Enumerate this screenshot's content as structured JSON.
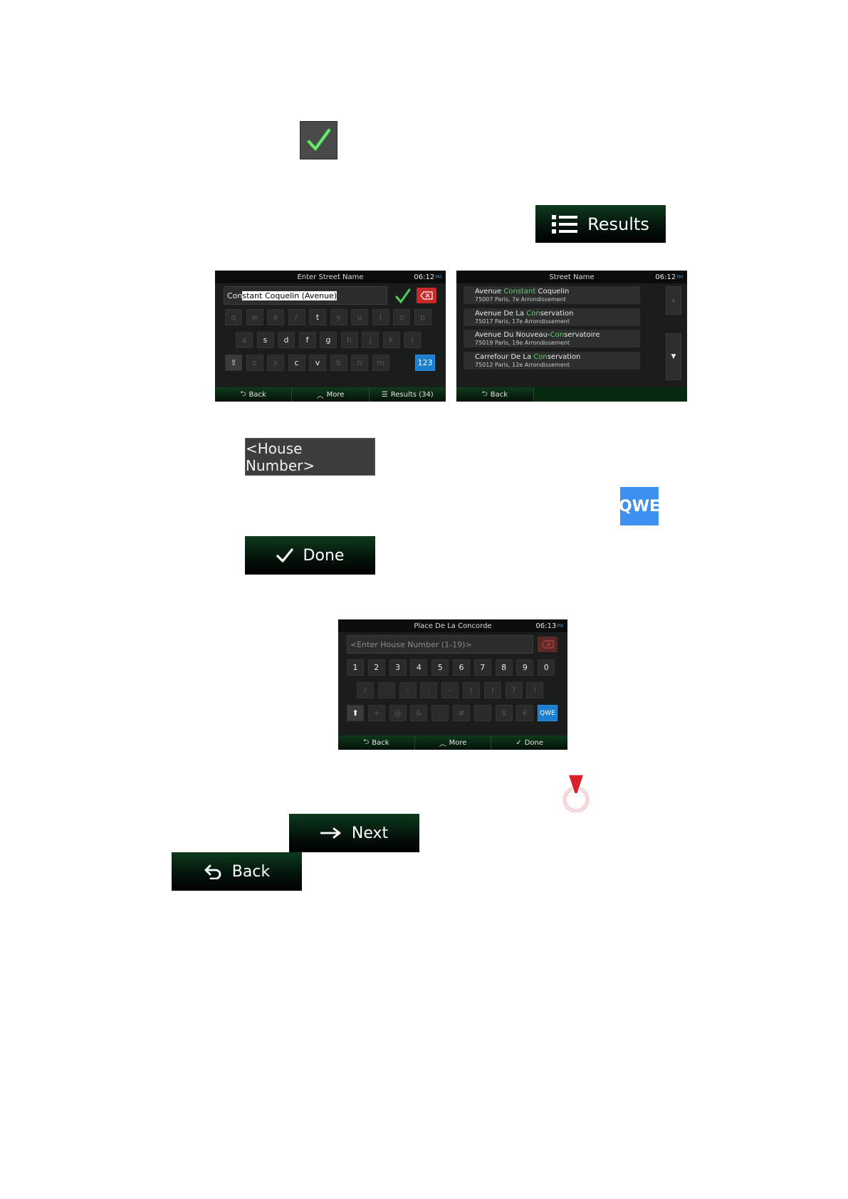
{
  "buttons": {
    "results_label": "Results",
    "house_number_label": "<House Number>",
    "qwe_label": "QWE",
    "done_label": "Done",
    "next_label": "Next",
    "back_label": "Back"
  },
  "screen_street_entry": {
    "title": "Enter Street Name",
    "time": "06:12",
    "time_suffix": "PM",
    "input_typed": "Con",
    "input_suggestion": "stant Coquelin (Avenue)",
    "keyboard": {
      "row1": [
        "q",
        "w",
        "e",
        "r",
        "t",
        "y",
        "u",
        "i",
        "o",
        "p"
      ],
      "row1_active": [
        false,
        false,
        false,
        false,
        true,
        false,
        false,
        false,
        false,
        false
      ],
      "row2": [
        "a",
        "s",
        "d",
        "f",
        "g",
        "h",
        "j",
        "k",
        "l"
      ],
      "row2_active": [
        false,
        true,
        true,
        true,
        true,
        false,
        false,
        false,
        false
      ],
      "row3": [
        "z",
        "x",
        "c",
        "v",
        "b",
        "n",
        "m"
      ],
      "row3_active": [
        false,
        false,
        true,
        true,
        false,
        false,
        false
      ],
      "num_key": "123"
    },
    "bottom": {
      "back": "Back",
      "more": "More",
      "results": "Results (34)"
    }
  },
  "screen_street_list": {
    "title": "Street Name",
    "time": "06:12",
    "time_suffix": "PM",
    "items": [
      {
        "pre": "Avenue ",
        "hl": "Constant",
        "post": " Coquelin",
        "sub": "75007 Paris, 7e Arrondissement"
      },
      {
        "pre": "Avenue De La ",
        "hl": "Con",
        "post": "servation",
        "sub": "75017 Paris, 17e Arrondissement"
      },
      {
        "pre": "Avenue Du Nouveau-",
        "hl": "Con",
        "post": "servatoire",
        "sub": "75019 Paris, 19e Arrondissement"
      },
      {
        "pre": "Carrefour De La ",
        "hl": "Con",
        "post": "servation",
        "sub": "75012 Paris, 12e Arrondissement"
      }
    ],
    "bottom": {
      "back": "Back"
    }
  },
  "screen_house_number": {
    "title": "Place De La Concorde",
    "time": "06:13",
    "time_suffix": "PM",
    "placeholder": "<Enter House Number (1-19)>",
    "digits": [
      "1",
      "2",
      "3",
      "4",
      "5",
      "6",
      "7",
      "8",
      "9",
      "0"
    ],
    "row2": [
      "/",
      "-",
      ":",
      ";",
      "-",
      "(",
      ")",
      "?",
      "!"
    ],
    "row3": [
      "+",
      "@",
      "&",
      "",
      "#",
      "",
      "$",
      "€"
    ],
    "qwe_key": "QWE",
    "bottom": {
      "back": "Back",
      "more": "More",
      "done": "Done"
    }
  },
  "icons": [
    "checkmark-icon",
    "list-icon",
    "arrow-right-icon",
    "back-arrow-icon",
    "map-pin-icon",
    "backspace-icon",
    "shift-icon",
    "chevron-up-icon",
    "scroll-down-icon"
  ],
  "colors": {
    "accent_green": "#5bd06a",
    "button_dark_green": "#0c3a1c",
    "key_blue": "#1e7fd0",
    "qwe_blue": "#3d8ff0",
    "delete_red": "#c92a2a"
  }
}
